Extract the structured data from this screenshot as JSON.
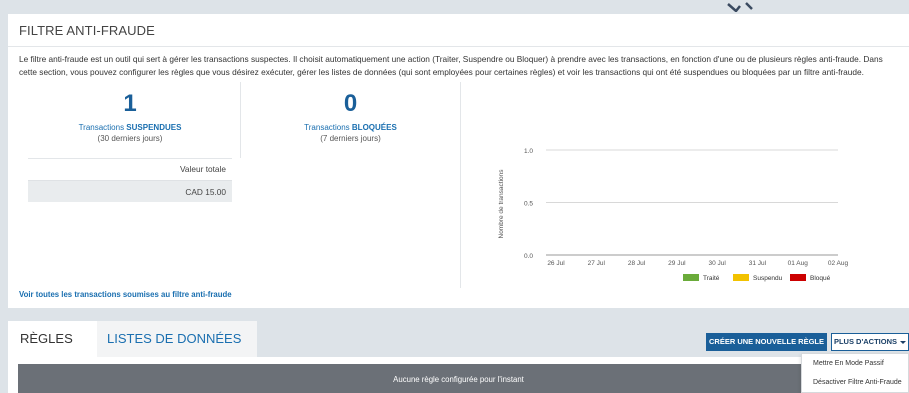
{
  "panel": {
    "title": "FILTRE ANTI-FRAUDE",
    "description": "Le filtre anti-fraude est un outil qui sert à gérer les transactions suspectes. Il choisit automatiquement une action (Traiter, Suspendre ou Bloquer) à prendre avec les transactions, en fonction d'une ou de plusieurs règles anti-fraude. Dans cette section, vous pouvez configurer les règles que vous désirez exécuter, gérer les listes de données (qui sont employées pour certaines règles) et voir les transactions qui ont été suspendues ou bloquées par un filtre anti-fraude."
  },
  "stats": {
    "suspended": {
      "count": "1",
      "label_prefix": "Transactions ",
      "label_strong": "SUSPENDUES",
      "period": "(30 derniers jours)"
    },
    "blocked": {
      "count": "0",
      "label_prefix": "Transactions ",
      "label_strong": "BLOQUÉES",
      "period": "(7 derniers jours)"
    },
    "total_header": "Valeur totale",
    "total_value": "CAD 15.00"
  },
  "links": {
    "view_all": "Voir toutes les transactions soumises au filtre anti-fraude"
  },
  "chart_data": {
    "type": "bar",
    "ylabel": "Nombre de transactions",
    "xlabel": "",
    "categories": [
      "26 Jul",
      "27 Jul",
      "28 Jul",
      "29 Jul",
      "30 Jul",
      "31 Jul",
      "01 Aug",
      "02 Aug"
    ],
    "yticks": [
      "0.0",
      "0.5",
      "1.0"
    ],
    "ylim": [
      0,
      1
    ],
    "grid": true,
    "legend_position": "bottom-right",
    "series": [
      {
        "name": "Traité",
        "color": "#6aab3a",
        "values": [
          0,
          0,
          0,
          0,
          0,
          0,
          0,
          0
        ]
      },
      {
        "name": "Suspendu",
        "color": "#f2c200",
        "values": [
          0,
          0,
          0,
          0,
          0,
          0,
          0,
          0
        ]
      },
      {
        "name": "Bloqué",
        "color": "#cc0000",
        "values": [
          0,
          0,
          0,
          0,
          0,
          0,
          0,
          0
        ]
      }
    ]
  },
  "tabs": {
    "rules": "RÈGLES",
    "lists": "LISTES DE DONNÉES"
  },
  "toolbar": {
    "create_rule": "CRÉER UNE NOUVELLE RÈGLE",
    "more_actions": "PLUS D'ACTIONS"
  },
  "rules_table": {
    "empty_message": "Aucune règle configurée pour l'instant"
  },
  "dropdown": {
    "items": [
      "Mettre En Mode Passif",
      "Désactiver Filtre Anti-Fraude"
    ]
  }
}
